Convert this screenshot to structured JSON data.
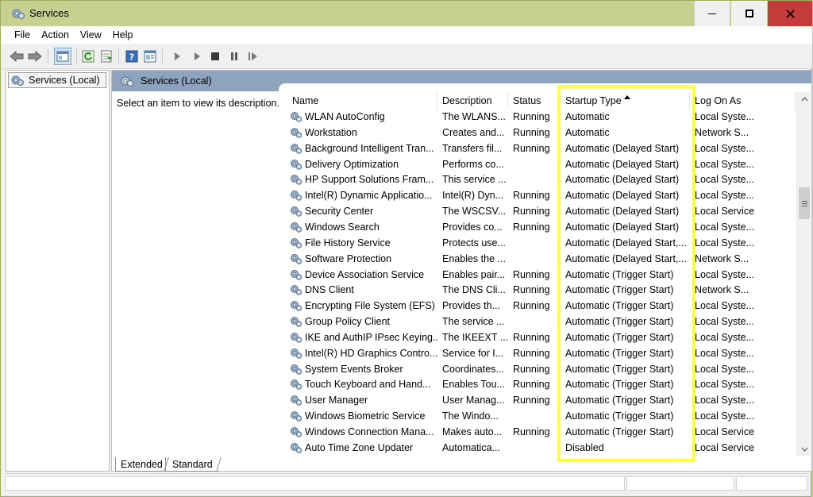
{
  "window": {
    "title": "Services"
  },
  "menu": [
    "File",
    "Action",
    "View",
    "Help"
  ],
  "toolbar": [
    "back-icon",
    "forward-icon",
    "show-hide-console-tree-icon",
    "refresh-icon",
    "export-list-icon",
    "help-icon",
    "properties-icon",
    "start-service-icon",
    "start-service-alt-icon",
    "stop-service-icon",
    "pause-service-icon",
    "restart-service-icon"
  ],
  "tree": {
    "root_label": "Services (Local)"
  },
  "content": {
    "header_title": "Services (Local)",
    "description_prompt": "Select an item to view its description."
  },
  "table": {
    "columns": [
      "Name",
      "Description",
      "Status",
      "Startup Type",
      "Log On As"
    ],
    "sorted_column": "Startup Type",
    "rows": [
      {
        "name": "WLAN AutoConfig",
        "description": "The WLANS...",
        "status": "Running",
        "startup": "Automatic",
        "logon": "Local Syste..."
      },
      {
        "name": "Workstation",
        "description": "Creates and...",
        "status": "Running",
        "startup": "Automatic",
        "logon": "Network S..."
      },
      {
        "name": "Background Intelligent Tran...",
        "description": "Transfers fil...",
        "status": "Running",
        "startup": "Automatic (Delayed Start)",
        "logon": "Local Syste..."
      },
      {
        "name": "Delivery Optimization",
        "description": "Performs co...",
        "status": "",
        "startup": "Automatic (Delayed Start)",
        "logon": "Local Syste..."
      },
      {
        "name": "HP Support Solutions Fram...",
        "description": "This service ...",
        "status": "",
        "startup": "Automatic (Delayed Start)",
        "logon": "Local Syste..."
      },
      {
        "name": "Intel(R) Dynamic Applicatio...",
        "description": "Intel(R) Dyn...",
        "status": "Running",
        "startup": "Automatic (Delayed Start)",
        "logon": "Local Syste..."
      },
      {
        "name": "Security Center",
        "description": "The WSCSV...",
        "status": "Running",
        "startup": "Automatic (Delayed Start)",
        "logon": "Local Service"
      },
      {
        "name": "Windows Search",
        "description": "Provides co...",
        "status": "Running",
        "startup": "Automatic (Delayed Start)",
        "logon": "Local Syste..."
      },
      {
        "name": "File History Service",
        "description": "Protects use...",
        "status": "",
        "startup": "Automatic (Delayed Start,...",
        "logon": "Local Syste..."
      },
      {
        "name": "Software Protection",
        "description": "Enables the ...",
        "status": "",
        "startup": "Automatic (Delayed Start,...",
        "logon": "Network S..."
      },
      {
        "name": "Device Association Service",
        "description": "Enables pair...",
        "status": "Running",
        "startup": "Automatic (Trigger Start)",
        "logon": "Local Syste..."
      },
      {
        "name": "DNS Client",
        "description": "The DNS Cli...",
        "status": "Running",
        "startup": "Automatic (Trigger Start)",
        "logon": "Network S..."
      },
      {
        "name": "Encrypting File System (EFS)",
        "description": "Provides th...",
        "status": "Running",
        "startup": "Automatic (Trigger Start)",
        "logon": "Local Syste..."
      },
      {
        "name": "Group Policy Client",
        "description": "The service ...",
        "status": "",
        "startup": "Automatic (Trigger Start)",
        "logon": "Local Syste..."
      },
      {
        "name": "IKE and AuthIP IPsec Keying...",
        "description": "The IKEEXT ...",
        "status": "Running",
        "startup": "Automatic (Trigger Start)",
        "logon": "Local Syste..."
      },
      {
        "name": "Intel(R) HD Graphics Contro...",
        "description": "Service for I...",
        "status": "Running",
        "startup": "Automatic (Trigger Start)",
        "logon": "Local Syste..."
      },
      {
        "name": "System Events Broker",
        "description": "Coordinates...",
        "status": "Running",
        "startup": "Automatic (Trigger Start)",
        "logon": "Local Syste..."
      },
      {
        "name": "Touch Keyboard and Hand...",
        "description": "Enables Tou...",
        "status": "Running",
        "startup": "Automatic (Trigger Start)",
        "logon": "Local Syste..."
      },
      {
        "name": "User Manager",
        "description": "User Manag...",
        "status": "Running",
        "startup": "Automatic (Trigger Start)",
        "logon": "Local Syste..."
      },
      {
        "name": "Windows Biometric Service",
        "description": "The Windo...",
        "status": "",
        "startup": "Automatic (Trigger Start)",
        "logon": "Local Syste..."
      },
      {
        "name": "Windows Connection Mana...",
        "description": "Makes auto...",
        "status": "Running",
        "startup": "Automatic (Trigger Start)",
        "logon": "Local Service"
      },
      {
        "name": "Auto Time Zone Updater",
        "description": "Automatica...",
        "status": "",
        "startup": "Disabled",
        "logon": "Local Service"
      }
    ]
  },
  "tabs": [
    "Extended",
    "Standard"
  ],
  "colors": {
    "title_bar": "#c8d08f",
    "close_button": "#c53b3b",
    "content_header": "#8ea3bd",
    "highlight": "#ffff3a"
  }
}
